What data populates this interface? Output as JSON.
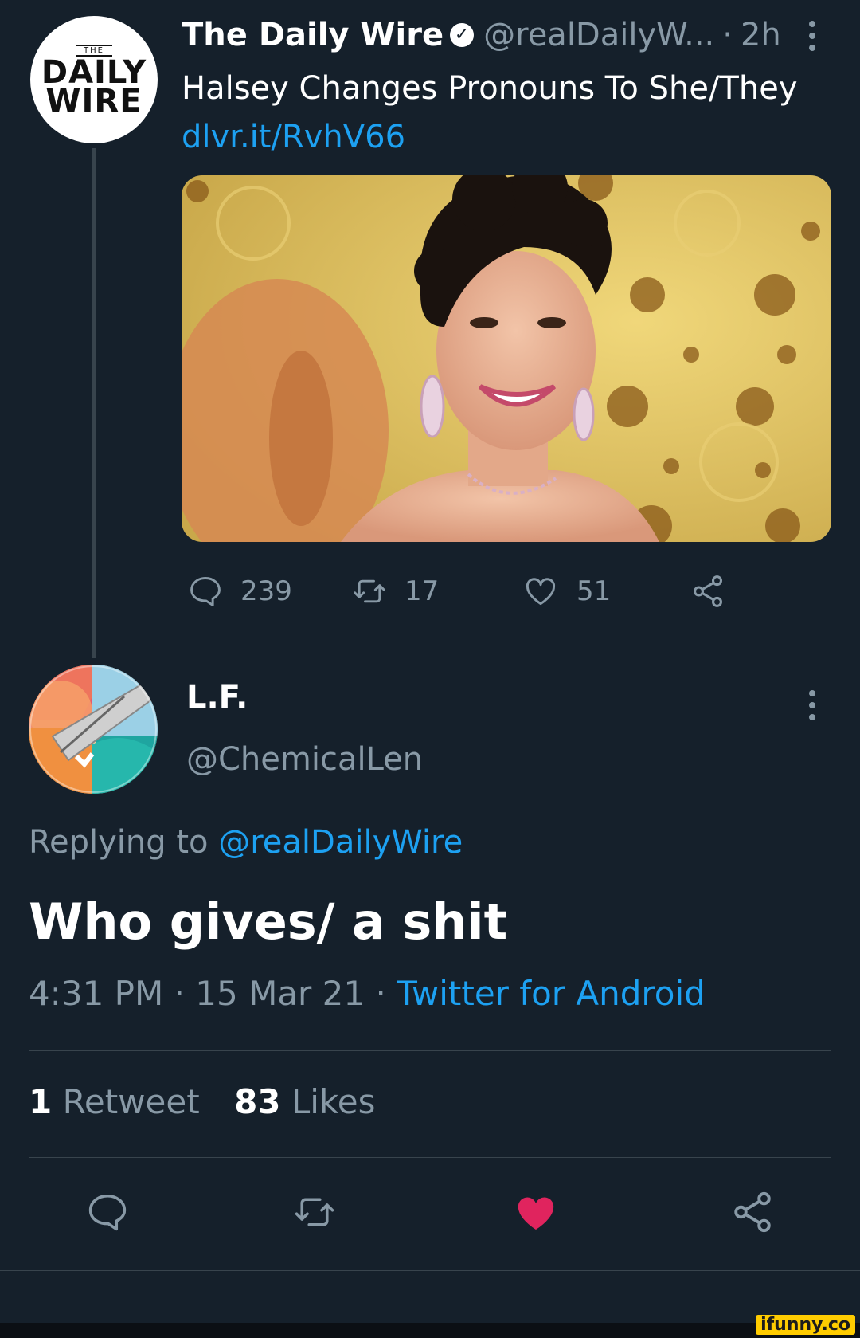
{
  "parent_tweet": {
    "author_name": "The Daily Wire",
    "handle": "@realDailyW...",
    "separator": "·",
    "time": "2h",
    "avatar_logo": {
      "line1": "DAILY",
      "line2": "WIRE",
      "the": "THE"
    },
    "text": "Halsey Changes Pronouns To She/They",
    "link": "dlvr.it/RvhV66",
    "actions": {
      "replies": "239",
      "retweets": "17",
      "likes": "51"
    }
  },
  "reply_tweet": {
    "author_name": "L.F.",
    "handle": "@ChemicalLen",
    "replying_prefix": "Replying to",
    "replying_handle": "@realDailyWire",
    "text": "Who gives/ a shit",
    "timestamp": "4:31 PM · 15 Mar 21 ·",
    "source": "Twitter for Android",
    "stats": {
      "retweet_count": "1",
      "retweet_label": "Retweet",
      "like_count": "83",
      "like_label": "Likes"
    }
  },
  "watermark": "ifunny.co",
  "colors": {
    "background": "#15202b",
    "accent": "#1da1f2",
    "muted": "#8899a6",
    "like": "#e0245e"
  },
  "icons": [
    "verified-badge-icon",
    "more-icon",
    "reply-icon",
    "retweet-icon",
    "like-icon",
    "share-icon"
  ]
}
